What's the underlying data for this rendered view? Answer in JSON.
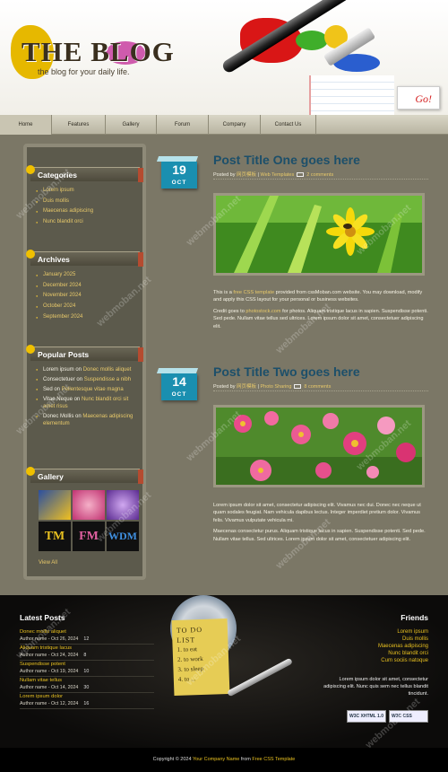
{
  "header": {
    "logo_text": "THE BLOG",
    "tagline": "the blog for your daily life.",
    "go_note": "Go!"
  },
  "nav": {
    "items": [
      {
        "label": "Home",
        "active": true
      },
      {
        "label": "Features"
      },
      {
        "label": "Gallery"
      },
      {
        "label": "Forum"
      },
      {
        "label": "Company"
      },
      {
        "label": "Contact Us"
      }
    ]
  },
  "sidebar": {
    "categories": {
      "title": "Categories",
      "items": [
        "Lorem ipsum",
        "Duis mollis",
        "Maecenas adipiscing",
        "Nunc blandit orci"
      ]
    },
    "archives": {
      "title": "Archives",
      "items": [
        "January 2025",
        "December 2024",
        "November 2024",
        "October 2024",
        "September 2024"
      ]
    },
    "popular": {
      "title": "Popular Posts",
      "items": [
        {
          "prefix": "Lorem ipsum on ",
          "link": "Donec mollis aliquet"
        },
        {
          "prefix": "Consectetuer on ",
          "link": "Suspendisse a nibh"
        },
        {
          "prefix": "Sed on ",
          "link": "Pellentesque vitae magna"
        },
        {
          "prefix": "Vitae Neque on ",
          "link": "Nunc blandit orci sit amet risus"
        },
        {
          "prefix": "Donec Mollis on ",
          "link": "Maecenas adipiscing elementum"
        }
      ]
    },
    "gallery": {
      "title": "Gallery",
      "thumbs": [
        "",
        "",
        "",
        "TM",
        "FM",
        "WDM"
      ],
      "view_all": "View All"
    }
  },
  "posts": [
    {
      "day": "19",
      "month": "OCT",
      "title": "Post Title One goes here",
      "meta_prefix": "Posted by ",
      "author": "网页模板",
      "sep": " | ",
      "category": "Web Templates",
      "comments": "2 comments",
      "para1_pre": "This is a ",
      "para1_link1": "free CSS template",
      "para1_mid": " provided from cssMoban.com website. You may download, modify and apply this CSS layout for your personal or business websites.",
      "para2_pre": "Credit goes to ",
      "para2_link": "photostock.com",
      "para2_post": " for photos. Aliquam tristique lacus in sapien. Suspendisse potenti. Sed pede. Nullam vitae tellus sed ultrices. Lorem ipsum dolor sit amet, consectetuer adipiscing elit."
    },
    {
      "day": "14",
      "month": "OCT",
      "title": "Post Title Two goes here",
      "meta_prefix": "Posted by ",
      "author": "网页模板",
      "sep": " | ",
      "category": "Photo Sharing",
      "comments": "8 comments",
      "para1": "Lorem ipsum dolor sit amet, consectetur adipiscing elit. Vivamus nec dui. Donec nec neque ut quam sodales feugiat. Nam vehicula dapibus lectus. Integer imperdiet pretium dolor. Vivamus felis. Vivamus vulputate vehicula mi.",
      "para2": "Maecenas consectetur purus. Aliquam tristique lacus in sapien. Suspendisse potenti. Sed pede. Nullam vitae tellus. Sed ultrices. Lorem ipsum dolor sit amet, consectetuer adipiscing elit."
    }
  ],
  "footer": {
    "latest_title": "Latest Posts",
    "latest": [
      {
        "title": "Donec mollis aliquet",
        "meta": "Author name - Oct 26, 2024",
        "count": "12"
      },
      {
        "title": "Aliquam tristique lacus",
        "meta": "Author name - Oct 24, 2024",
        "count": "8"
      },
      {
        "title": "Suspendisse potent",
        "meta": "Author name - Oct 19, 2024",
        "count": "10"
      },
      {
        "title": "Nullam vitae tellus",
        "meta": "Author name - Oct 14, 2024",
        "count": "30"
      },
      {
        "title": "Lorem ipsum dolor",
        "meta": "Author name - Oct 12, 2024",
        "count": "16"
      }
    ],
    "todo": {
      "title": "TO DO LIST",
      "items": [
        "1. to eat",
        "2. to work",
        "3. to sleep",
        "4. to ..."
      ]
    },
    "friends_title": "Friends",
    "friends": [
      "Lorem ipsum",
      "Duis mollis",
      "Maecenas adipiscing",
      "Nunc blandit orci",
      "Cum sociis natoque"
    ],
    "friends_text": "Lorem ipsum dolor sit amet, consectetur adipiscing elit. Nunc quis sem nec tellus blandit tincidunt.",
    "badges": [
      "W3C XHTML 1.0",
      "W3C CSS"
    ]
  },
  "copyright": {
    "pre": "Copyright © 2024 ",
    "company": "Your Company Name",
    "mid": " from ",
    "link": "Free CSS Template"
  },
  "watermark": "webmoban.net"
}
